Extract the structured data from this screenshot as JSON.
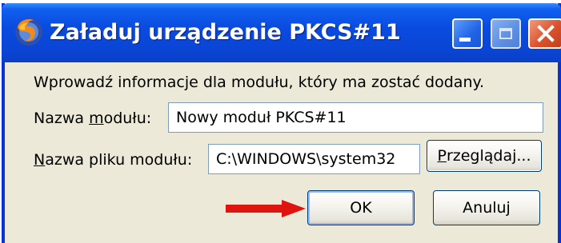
{
  "window": {
    "title": "Załaduj urządzenie PKCS#11",
    "icon": "firefox-icon"
  },
  "titlebar_buttons": {
    "minimize": "minimize-icon",
    "maximize": "maximize-icon",
    "close": "close-icon"
  },
  "dialog": {
    "intro": "Wprowadź informacje dla modułu, który ma zostać dodany.",
    "module_name": {
      "label_before": "Nazwa ",
      "label_mnemonic": "m",
      "label_after": "odułu:",
      "value": "Nowy moduł PKCS#11"
    },
    "module_file": {
      "label_mnemonic": "N",
      "label_after": "azwa pliku modułu:",
      "value": "C:\\WINDOWS\\system32"
    },
    "browse_button": {
      "mnemonic": "P",
      "label_after": "rzeglądaj..."
    },
    "ok_button": "OK",
    "cancel_button": "Anuluj"
  },
  "annotation": {
    "arrow_color": "#E0140F"
  }
}
